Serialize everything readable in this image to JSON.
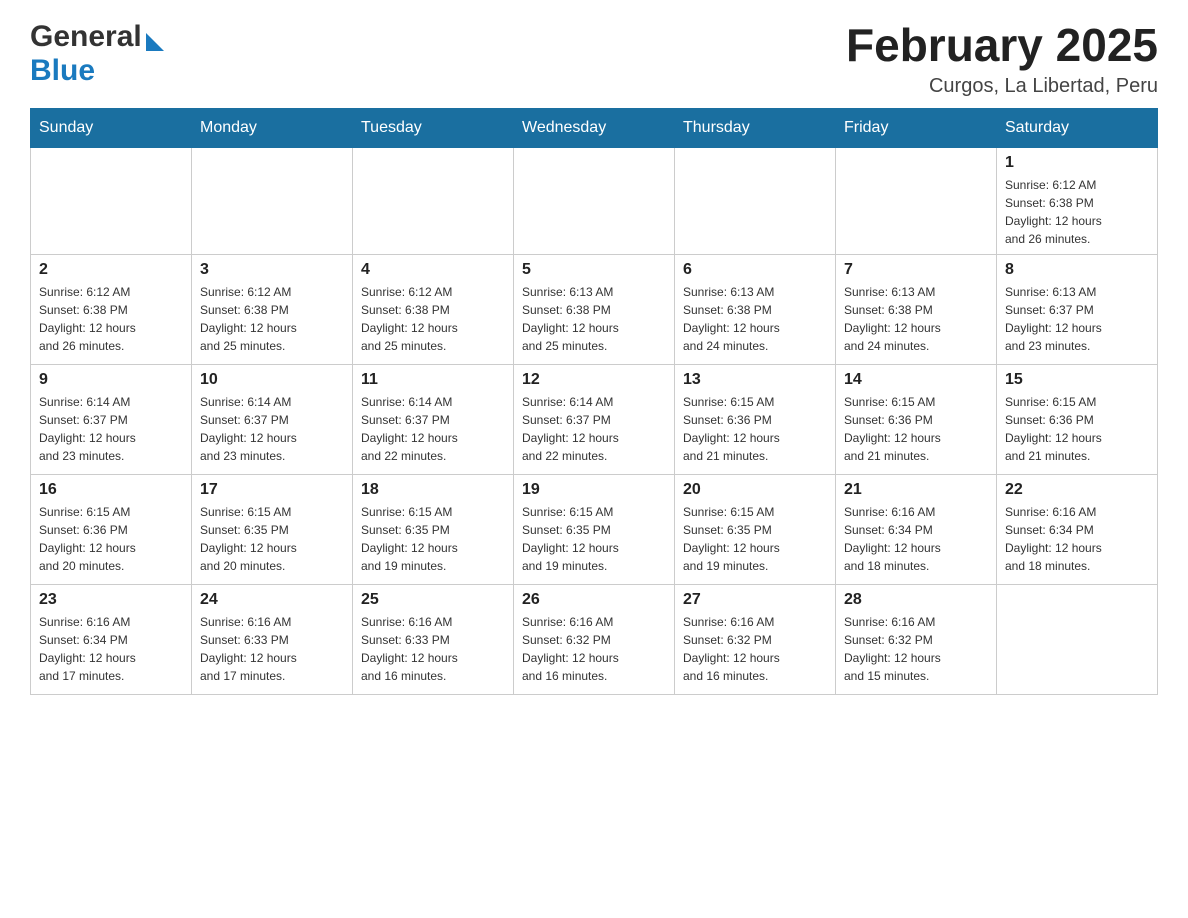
{
  "header": {
    "logo_general": "General",
    "logo_blue": "Blue",
    "title": "February 2025",
    "location": "Curgos, La Libertad, Peru"
  },
  "weekdays": [
    "Sunday",
    "Monday",
    "Tuesday",
    "Wednesday",
    "Thursday",
    "Friday",
    "Saturday"
  ],
  "weeks": [
    [
      {
        "day": "",
        "info": ""
      },
      {
        "day": "",
        "info": ""
      },
      {
        "day": "",
        "info": ""
      },
      {
        "day": "",
        "info": ""
      },
      {
        "day": "",
        "info": ""
      },
      {
        "day": "",
        "info": ""
      },
      {
        "day": "1",
        "info": "Sunrise: 6:12 AM\nSunset: 6:38 PM\nDaylight: 12 hours\nand 26 minutes."
      }
    ],
    [
      {
        "day": "2",
        "info": "Sunrise: 6:12 AM\nSunset: 6:38 PM\nDaylight: 12 hours\nand 26 minutes."
      },
      {
        "day": "3",
        "info": "Sunrise: 6:12 AM\nSunset: 6:38 PM\nDaylight: 12 hours\nand 25 minutes."
      },
      {
        "day": "4",
        "info": "Sunrise: 6:12 AM\nSunset: 6:38 PM\nDaylight: 12 hours\nand 25 minutes."
      },
      {
        "day": "5",
        "info": "Sunrise: 6:13 AM\nSunset: 6:38 PM\nDaylight: 12 hours\nand 25 minutes."
      },
      {
        "day": "6",
        "info": "Sunrise: 6:13 AM\nSunset: 6:38 PM\nDaylight: 12 hours\nand 24 minutes."
      },
      {
        "day": "7",
        "info": "Sunrise: 6:13 AM\nSunset: 6:38 PM\nDaylight: 12 hours\nand 24 minutes."
      },
      {
        "day": "8",
        "info": "Sunrise: 6:13 AM\nSunset: 6:37 PM\nDaylight: 12 hours\nand 23 minutes."
      }
    ],
    [
      {
        "day": "9",
        "info": "Sunrise: 6:14 AM\nSunset: 6:37 PM\nDaylight: 12 hours\nand 23 minutes."
      },
      {
        "day": "10",
        "info": "Sunrise: 6:14 AM\nSunset: 6:37 PM\nDaylight: 12 hours\nand 23 minutes."
      },
      {
        "day": "11",
        "info": "Sunrise: 6:14 AM\nSunset: 6:37 PM\nDaylight: 12 hours\nand 22 minutes."
      },
      {
        "day": "12",
        "info": "Sunrise: 6:14 AM\nSunset: 6:37 PM\nDaylight: 12 hours\nand 22 minutes."
      },
      {
        "day": "13",
        "info": "Sunrise: 6:15 AM\nSunset: 6:36 PM\nDaylight: 12 hours\nand 21 minutes."
      },
      {
        "day": "14",
        "info": "Sunrise: 6:15 AM\nSunset: 6:36 PM\nDaylight: 12 hours\nand 21 minutes."
      },
      {
        "day": "15",
        "info": "Sunrise: 6:15 AM\nSunset: 6:36 PM\nDaylight: 12 hours\nand 21 minutes."
      }
    ],
    [
      {
        "day": "16",
        "info": "Sunrise: 6:15 AM\nSunset: 6:36 PM\nDaylight: 12 hours\nand 20 minutes."
      },
      {
        "day": "17",
        "info": "Sunrise: 6:15 AM\nSunset: 6:35 PM\nDaylight: 12 hours\nand 20 minutes."
      },
      {
        "day": "18",
        "info": "Sunrise: 6:15 AM\nSunset: 6:35 PM\nDaylight: 12 hours\nand 19 minutes."
      },
      {
        "day": "19",
        "info": "Sunrise: 6:15 AM\nSunset: 6:35 PM\nDaylight: 12 hours\nand 19 minutes."
      },
      {
        "day": "20",
        "info": "Sunrise: 6:15 AM\nSunset: 6:35 PM\nDaylight: 12 hours\nand 19 minutes."
      },
      {
        "day": "21",
        "info": "Sunrise: 6:16 AM\nSunset: 6:34 PM\nDaylight: 12 hours\nand 18 minutes."
      },
      {
        "day": "22",
        "info": "Sunrise: 6:16 AM\nSunset: 6:34 PM\nDaylight: 12 hours\nand 18 minutes."
      }
    ],
    [
      {
        "day": "23",
        "info": "Sunrise: 6:16 AM\nSunset: 6:34 PM\nDaylight: 12 hours\nand 17 minutes."
      },
      {
        "day": "24",
        "info": "Sunrise: 6:16 AM\nSunset: 6:33 PM\nDaylight: 12 hours\nand 17 minutes."
      },
      {
        "day": "25",
        "info": "Sunrise: 6:16 AM\nSunset: 6:33 PM\nDaylight: 12 hours\nand 16 minutes."
      },
      {
        "day": "26",
        "info": "Sunrise: 6:16 AM\nSunset: 6:32 PM\nDaylight: 12 hours\nand 16 minutes."
      },
      {
        "day": "27",
        "info": "Sunrise: 6:16 AM\nSunset: 6:32 PM\nDaylight: 12 hours\nand 16 minutes."
      },
      {
        "day": "28",
        "info": "Sunrise: 6:16 AM\nSunset: 6:32 PM\nDaylight: 12 hours\nand 15 minutes."
      },
      {
        "day": "",
        "info": ""
      }
    ]
  ]
}
